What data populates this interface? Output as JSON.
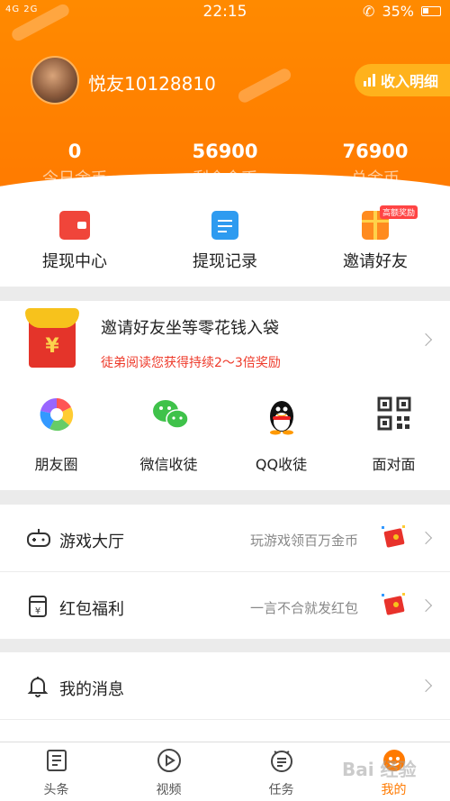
{
  "status_bar": {
    "network": "4G 2G",
    "time": "22:15",
    "battery": "35%"
  },
  "profile": {
    "username": "悦友10128810",
    "income_button": "收入明细"
  },
  "stats": [
    {
      "value": "0",
      "label": "今日金币"
    },
    {
      "value": "56900",
      "label": "剩余金币"
    },
    {
      "value": "76900",
      "label": "总金币"
    }
  ],
  "quick_actions": [
    {
      "label": "提现中心",
      "icon": "wallet-icon"
    },
    {
      "label": "提现记录",
      "icon": "record-icon"
    },
    {
      "label": "邀请好友",
      "icon": "gift-icon",
      "badge": "高额奖励"
    }
  ],
  "invite": {
    "title": "邀请好友坐等零花钱入袋",
    "subtitle": "徒弟阅读您获得持续2～3倍奖励",
    "yen": "¥"
  },
  "share": [
    {
      "label": "朋友圈",
      "icon": "moments-icon"
    },
    {
      "label": "微信收徒",
      "icon": "wechat-icon"
    },
    {
      "label": "QQ收徒",
      "icon": "qq-icon"
    },
    {
      "label": "面对面",
      "icon": "qrcode-icon"
    }
  ],
  "list": [
    {
      "title": "游戏大厅",
      "desc": "玩游戏领百万金币",
      "icon": "gamepad-icon"
    },
    {
      "title": "红包福利",
      "desc": "一言不合就发红包",
      "icon": "red-envelope-icon"
    },
    {
      "title": "我的消息",
      "desc": "",
      "icon": "bell-icon"
    }
  ],
  "nav": [
    {
      "label": "头条",
      "icon": "news-icon"
    },
    {
      "label": "视频",
      "icon": "video-icon"
    },
    {
      "label": "任务",
      "icon": "task-icon"
    },
    {
      "label": "我的",
      "icon": "me-icon"
    }
  ],
  "colors": {
    "brand": "#ff7a00",
    "accent_red": "#ee3b2b",
    "income_button": "#ffb21c"
  }
}
